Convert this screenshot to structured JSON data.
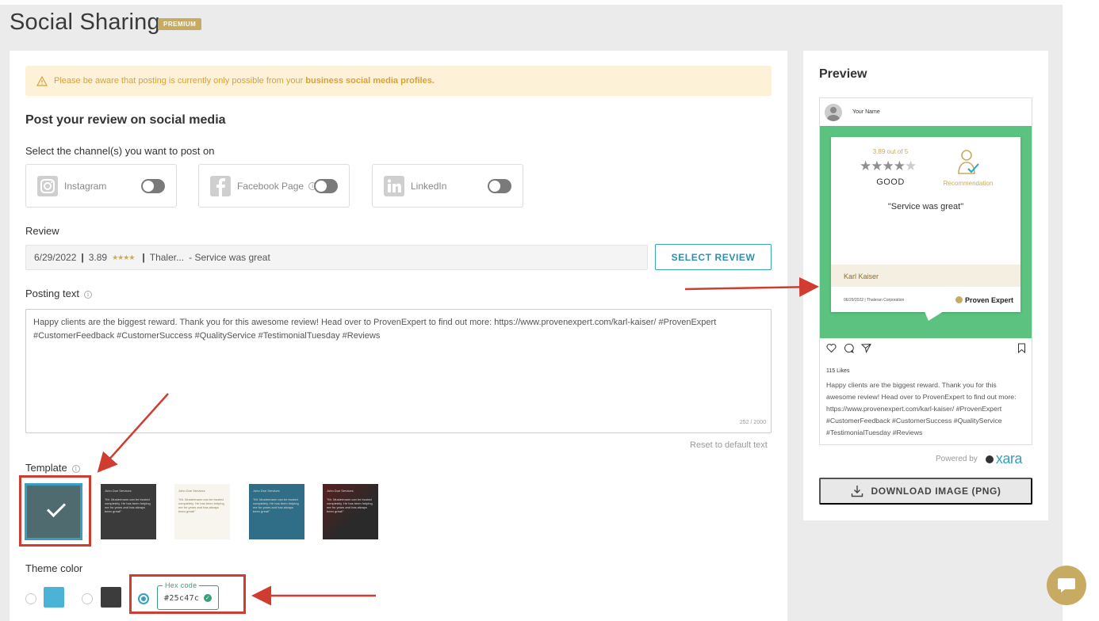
{
  "header": {
    "title": "Social Sharing",
    "badge": "PREMIUM"
  },
  "alert": {
    "text": "Please be aware that posting is currently only possible from your",
    "bold_text": "business social media profiles."
  },
  "post_section": {
    "heading": "Post your review on social media",
    "channels_label": "Select the channel(s) you want to post on",
    "channels": [
      {
        "label": "Instagram",
        "enabled": false
      },
      {
        "label": "Facebook Page",
        "enabled": false
      },
      {
        "label": "LinkedIn",
        "enabled": false
      }
    ]
  },
  "review": {
    "label": "Review",
    "date": "6/29/2022",
    "rating": "3.89",
    "stars": "★★★★",
    "company": "Thaler...",
    "text": "- Service was great",
    "select_button": "SELECT REVIEW"
  },
  "posting": {
    "label": "Posting text",
    "text": "Happy clients are the biggest reward. Thank you for this awesome review! Head over to ProvenExpert to find out more: https://www.provenexpert.com/karl-kaiser/ #ProvenExpert #CustomerFeedback #CustomerSuccess #QualityService #TestimonialTuesday #Reviews",
    "char_count": "252 / 2000",
    "reset_link": "Reset to default text"
  },
  "template": {
    "label": "Template",
    "items": [
      {
        "name": "",
        "quote": ""
      },
      {
        "name": "John Doe Services",
        "quote": "\"Mr. Mustermann can be trusted completely. He has been helping me for years and has always been great!\""
      },
      {
        "name": "John Doe Services",
        "quote": "\"Mr. Mustermann can be trusted completely. He has been helping me for years and has always been great!\""
      },
      {
        "name": "John Doe Services",
        "quote": "\"Mr. Mustermann can be trusted completely. He has been helping me for years and has always been great!\""
      },
      {
        "name": "John Doe Services",
        "quote": "\"Mr. Mustermann can be trusted completely. He has been helping me for years and has always been great!\""
      }
    ],
    "selected_index": 0
  },
  "theme": {
    "label": "Theme color",
    "colors": [
      "#4bb3d6",
      "#3c3c3c"
    ],
    "hex_label": "Hex code",
    "hex_value": "#25c47c",
    "selected": "custom"
  },
  "preview": {
    "title": "Preview",
    "user_name": "Your Name",
    "rating_text": "3.89 out of 5",
    "stars": "★★★★",
    "star_empty": "★",
    "grade": "GOOD",
    "recommendation": "Recommendation",
    "quote": "\"Service was great\"",
    "author": "Karl Kaiser",
    "footer_date": "06/29/2022 | Thaleran Corporation",
    "logo": "Proven Expert",
    "likes": "115 Likes",
    "caption": "Happy clients are the biggest reward. Thank you for this awesome review! Head over to ProvenExpert to find out more: https://www.provenexpert.com/karl-kaiser/ #ProvenExpert #CustomerFeedback #CustomerSuccess #QualityService #TestimonialTuesday #Reviews",
    "powered_by": "Powered by",
    "powered_logo": "xara",
    "download_button": "DOWNLOAD IMAGE (PNG)"
  },
  "colors": {
    "accent": "#3a9ec0",
    "gold": "#c8ab63",
    "preview_green": "#5bc27f",
    "annotation_red": "#d13c31"
  }
}
